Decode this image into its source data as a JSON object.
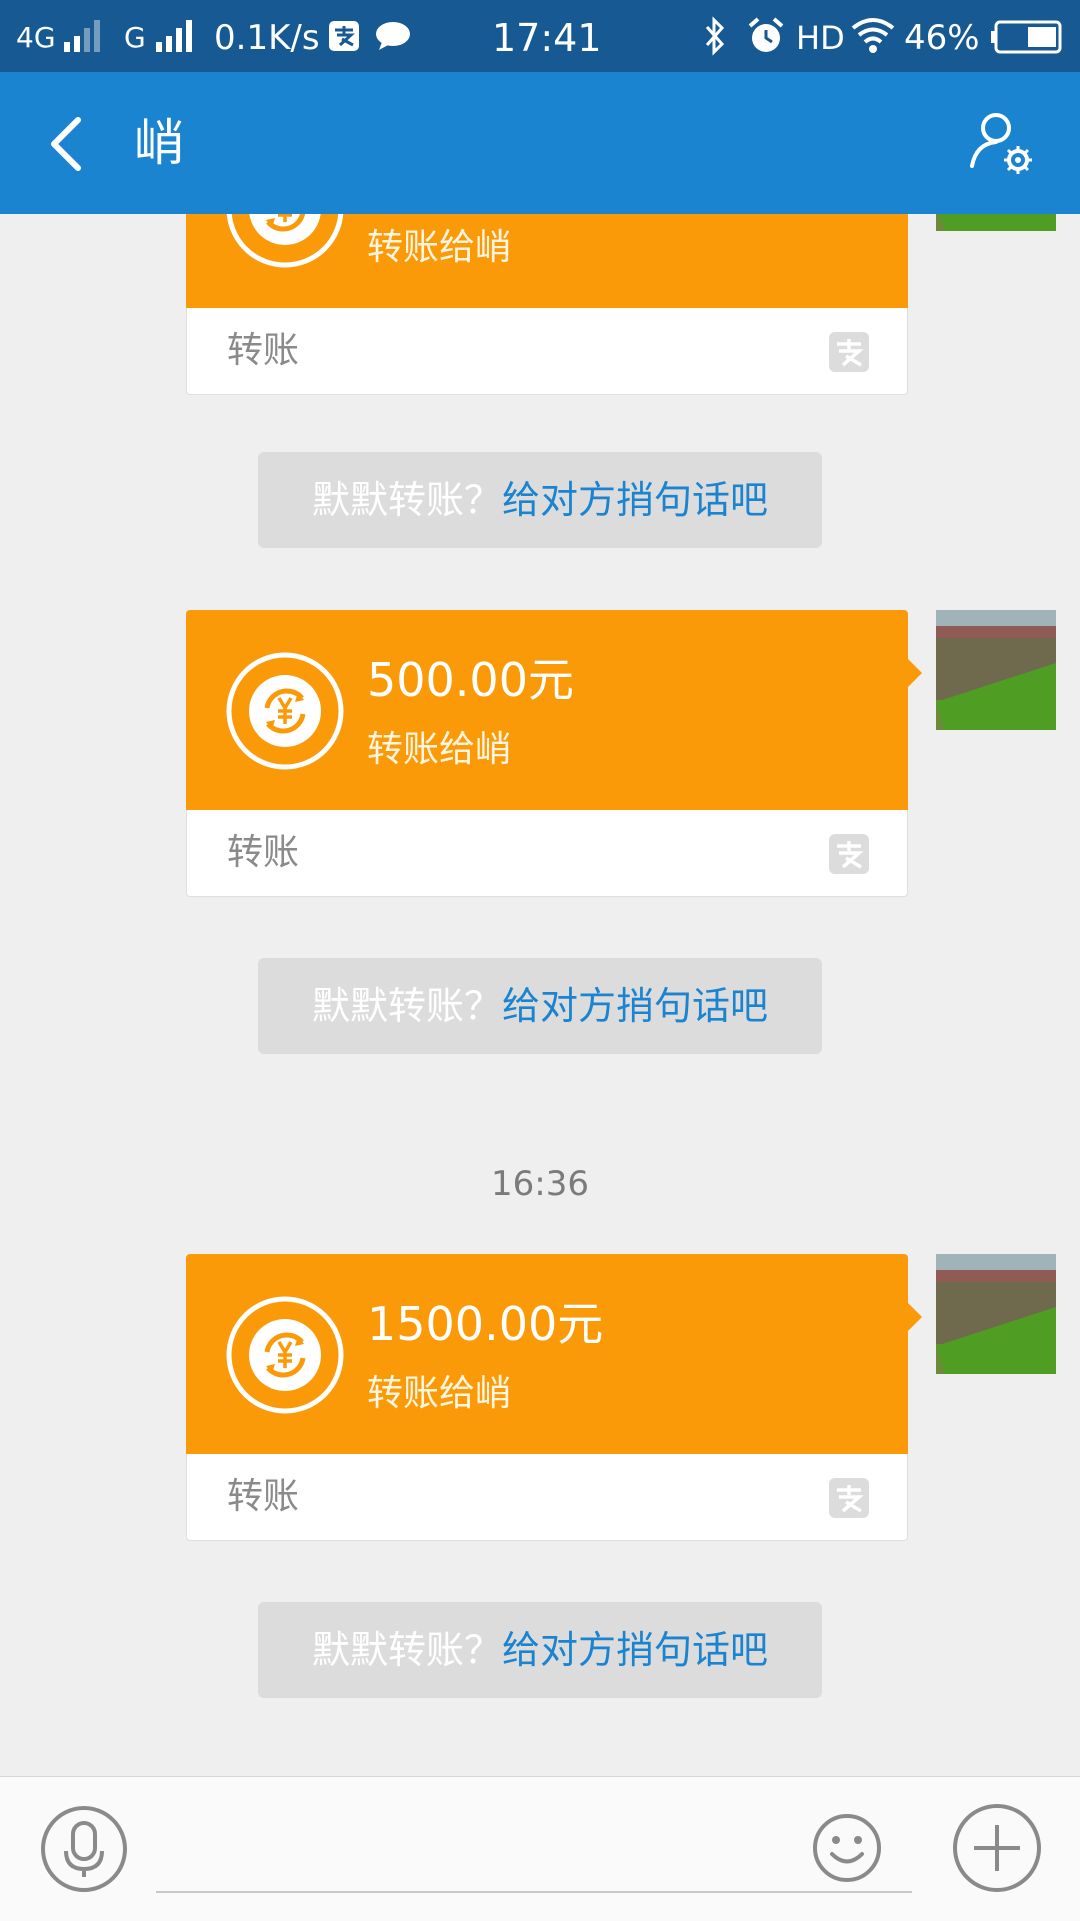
{
  "status_bar": {
    "network_1": "4G",
    "network_2": "G",
    "speed": "0.1K/s",
    "time": "17:41",
    "hd": "HD",
    "battery": "46%"
  },
  "header": {
    "title": "峭"
  },
  "messages": [
    {
      "amount": "",
      "subtitle": "转账给峭",
      "label": "转账"
    },
    {
      "amount": "500.00元",
      "subtitle": "转账给峭",
      "label": "转账"
    },
    {
      "amount": "1500.00元",
      "subtitle": "转账给峭",
      "label": "转账"
    }
  ],
  "hint": {
    "prefix": "默默转账？",
    "link": "给对方捎句话吧"
  },
  "timestamp": "16:36",
  "input": {
    "placeholder": ""
  },
  "colors": {
    "status_bar": "#175a93",
    "app_bar": "#1b84d1",
    "transfer_card": "#fb9a08",
    "link": "#1b84d1",
    "background": "#efefef"
  },
  "icons": {
    "back": "chevron-left-icon",
    "contact_settings": "user-gear-icon",
    "transfer": "yuan-exchange-icon",
    "alipay": "alipay-icon",
    "voice": "microphone-icon",
    "emoji": "smiley-icon",
    "more": "plus-circle-icon"
  }
}
